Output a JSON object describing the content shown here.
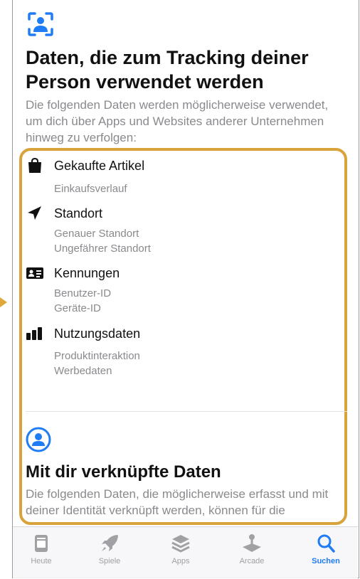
{
  "tracking_section": {
    "icon": "person-tracking-icon",
    "title": "Daten, die zum Tracking deiner Person verwendet werden",
    "description": "Die folgenden Daten werden möglicherweise verwendet, um dich über Apps und Websites anderer Unternehmen hinweg zu verfolgen:",
    "categories": [
      {
        "icon": "bag-icon",
        "label": "Gekaufte Artikel",
        "items": [
          "Einkaufsverlauf"
        ]
      },
      {
        "icon": "location-arrow-icon",
        "label": "Standort",
        "items": [
          "Genauer Standort",
          "Ungefährer Standort"
        ]
      },
      {
        "icon": "id-card-icon",
        "label": "Kennungen",
        "items": [
          "Benutzer-ID",
          "Geräte-ID"
        ]
      },
      {
        "icon": "bar-chart-icon",
        "label": "Nutzungsdaten",
        "items": [
          "Produktinteraktion",
          "Werbedaten"
        ]
      }
    ]
  },
  "linked_section": {
    "icon": "person-circle-icon",
    "title": "Mit dir verknüpfte Daten",
    "description": "Die folgenden Daten, die möglicherweise erfasst und mit deiner Identität verknüpft werden, können für die"
  },
  "tab_bar": {
    "tabs": [
      {
        "label": "Heute",
        "icon": "today-icon",
        "active": false
      },
      {
        "label": "Spiele",
        "icon": "rocket-icon",
        "active": false
      },
      {
        "label": "Apps",
        "icon": "apps-stack-icon",
        "active": false
      },
      {
        "label": "Arcade",
        "icon": "joystick-icon",
        "active": false
      },
      {
        "label": "Suchen",
        "icon": "search-icon",
        "active": true
      }
    ]
  },
  "colors": {
    "accent": "#1f7cf5",
    "highlight_border": "#d9a33c",
    "secondary_text": "#8a8a8e"
  }
}
